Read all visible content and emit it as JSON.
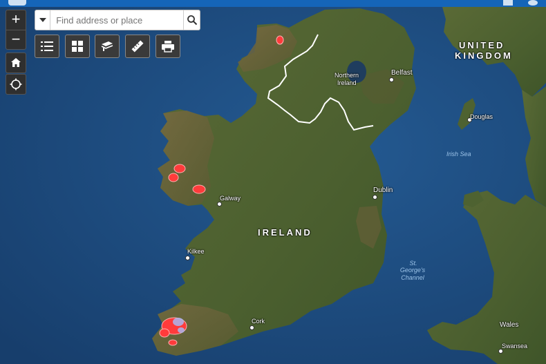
{
  "colors": {
    "sea": "#1d4f85",
    "land": "#4c5f30",
    "border_line": "#ffffff",
    "hotspot": "#ff3333",
    "header": "#1565b8"
  },
  "search": {
    "placeholder": "Find address or place"
  },
  "toolbar": {
    "icons": [
      "legend-list-icon",
      "basemap-grid-icon",
      "layers-icon",
      "measure-ruler-icon",
      "print-icon"
    ]
  },
  "map_controls": {
    "zoom_in": "+",
    "zoom_out": "−",
    "icons": [
      "home-icon",
      "locate-icon"
    ]
  },
  "labels": {
    "countries": {
      "united": "UNITED",
      "kingdom": "KINGDOM",
      "ireland": "IRELAND"
    },
    "regions": {
      "northern": "Northern",
      "ireland": "Ireland"
    },
    "cities": {
      "belfast": "Belfast",
      "douglas": "Douglas",
      "dublin": "Dublin",
      "galway": "Galway",
      "kilkee": "Kilkee",
      "cork": "Cork",
      "wales": "Wales",
      "swansea": "Swansea"
    },
    "water": {
      "irish_sea": "Irish Sea",
      "st": "St.",
      "georges": "George's",
      "channel": "Channel"
    }
  }
}
